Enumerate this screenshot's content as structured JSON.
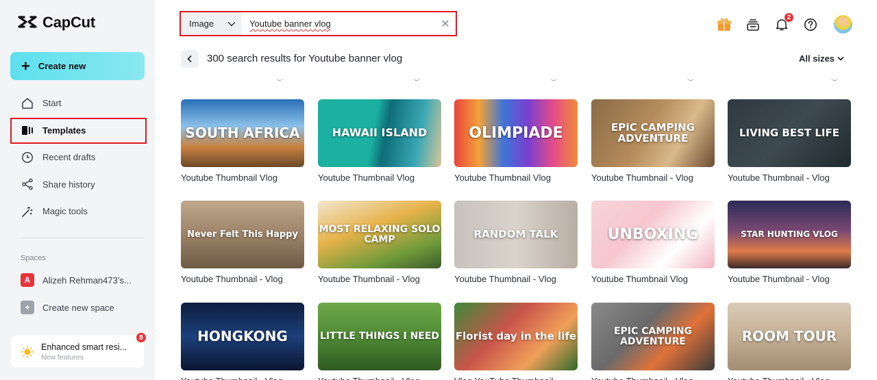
{
  "app": {
    "name": "CapCut"
  },
  "sidebar": {
    "create_label": "Create new",
    "items": [
      {
        "label": "Start",
        "icon": "home-icon"
      },
      {
        "label": "Templates",
        "icon": "templates-icon",
        "active": true
      },
      {
        "label": "Recent drafts",
        "icon": "clock-icon"
      },
      {
        "label": "Share history",
        "icon": "share-icon"
      },
      {
        "label": "Magic tools",
        "icon": "magic-wand-icon"
      }
    ],
    "spaces_label": "Spaces",
    "spaces": [
      {
        "label": "Alizeh Rehman473’s...",
        "initial": "A"
      },
      {
        "label": "Create new space",
        "initial": "+"
      }
    ],
    "promo": {
      "title": "Enhanced smart resi...",
      "subtitle": "New features",
      "badge": "8"
    }
  },
  "search": {
    "type_label": "Image",
    "query": "Youtube banner vlog"
  },
  "header": {
    "notification_count": "2"
  },
  "results": {
    "title": "300 search results for Youtube banner vlog",
    "size_filter": "All sizes"
  },
  "templates": [
    {
      "title": "SOUTH AFRICA",
      "caption": "Youtube Thumbnail Vlog",
      "bg": "linear-gradient(180deg,#2a6fb8 0%,#8cc1e8 40%,#c9823f 70%,#6b4a2a 100%)",
      "size": 20
    },
    {
      "title": "HAWAII ISLAND",
      "caption": "Youtube Thumbnail Vlog",
      "bg": "linear-gradient(100deg,#1bb0a0 0%,#1bb0a0 45%,#0e6d78 55%,#3aa8b4 80%,#d7c59a 100%)",
      "size": 16
    },
    {
      "title": "OLIMPIADE",
      "caption": "Youtube Thumbnail Vlog",
      "bg": "linear-gradient(90deg,#e8453c 0%,#f2a23a 20%,#3f74d8 40%,#7a3fd0 60%,#e34b8a 80%,#f28a3a 100%)",
      "size": 22
    },
    {
      "title": "EPIC CAMPING ADVENTURE",
      "caption": "Youtube Thumbnail - Vlog",
      "bg": "linear-gradient(120deg,#8a6b46 0%,#b58c5c 45%,#d9b98a 70%,#6c4c33 100%)",
      "size": 15
    },
    {
      "title": "LIVING BEST LIFE",
      "caption": "Youtube Thumbnail - Vlog",
      "bg": "linear-gradient(135deg,#2e3a40 0%,#3d4a4f 50%,#1f2a2e 100%)",
      "size": 15
    },
    {
      "title": "Never Felt This Happy",
      "caption": "Youtube Thumbnail - Vlog",
      "bg": "linear-gradient(180deg,#bfa88c 0%,#9c8369 50%,#6e5a46 100%)",
      "size": 13
    },
    {
      "title": "MOST RELAXING SOLO CAMP",
      "caption": "Youtube Thumbnail - Vlog",
      "bg": "linear-gradient(160deg,#f2e7cf 0%,#e6b24a 40%,#6f9a3a 75%,#3c5a2a 100%)",
      "size": 14
    },
    {
      "title": "RANDOM TALK",
      "caption": "Youtube Thumbnail - Vlog",
      "bg": "linear-gradient(90deg,#c7c2bc 0%,#d9d3cb 50%,#b8aea4 100%)",
      "size": 15
    },
    {
      "title": "UNBOXING",
      "caption": "Youtube Thumbnail Vlog",
      "bg": "linear-gradient(135deg,#f6d4d8 0%,#f7c6cf 40%,#ffffff 70%,#f2b4c2 100%)",
      "size": 22
    },
    {
      "title": "STAR HUNTING VLOG",
      "caption": "Youtube Thumbnail - Vlog",
      "bg": "linear-gradient(180deg,#2b2a57 0%,#7a4a72 45%,#e07b4a 75%,#3a2a2a 100%)",
      "size": 12
    },
    {
      "title": "HONGKONG",
      "caption": "Youtube Thumbnail - Vlog",
      "bg": "linear-gradient(180deg,#0d1f3f 0%,#1c3f7a 50%,#0a1630 100%)",
      "size": 20
    },
    {
      "title": "LITTLE THINGS I NEED",
      "caption": "Youtube Thumbnail - Vlog",
      "bg": "linear-gradient(180deg,#6fa84a 0%,#4f8a35 50%,#2e5a22 100%)",
      "size": 14
    },
    {
      "title": "Florist day in the life",
      "caption": "Vlog YouTube Thumbnail",
      "bg": "linear-gradient(135deg,#3f8a3a 0%,#c9544a 40%,#f0a05a 70%,#2f6a2a 100%)",
      "size": 15
    },
    {
      "title": "EPIC CAMPING ADVENTURE",
      "caption": "Youtube Thumbnail - Vlog",
      "bg": "linear-gradient(135deg,#8a8a8a 0%,#6a6a6a 40%,#e0723a 65%,#3a3a3a 100%)",
      "size": 14
    },
    {
      "title": "ROOM TOUR",
      "caption": "Youtube Thumbnail - Vlog",
      "bg": "linear-gradient(180deg,#d9cbb6 0%,#c4b096 50%,#a38d72 100%)",
      "size": 20
    }
  ]
}
